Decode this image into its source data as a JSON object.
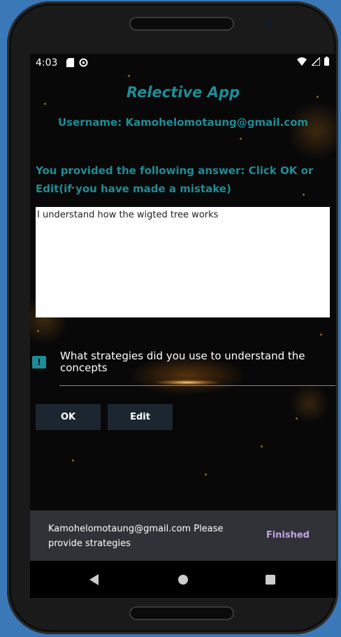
{
  "status_bar": {
    "time": "4:03",
    "left_icons": [
      "sd-card-icon",
      "sync-icon"
    ],
    "right_icons": [
      "wifi-icon",
      "signal-icon",
      "battery-icon"
    ]
  },
  "app": {
    "title": "Relective App",
    "username_label": "Username: Kamohelomotaung@gmail.com",
    "prompt": "You provided the following answer: Click OK or Edit(if you have made a mistake)",
    "answer": "I understand how the wigted tree works",
    "question": "What strategies did you use to understand the concepts",
    "ok_label": "OK",
    "edit_label": "Edit"
  },
  "snackbar": {
    "message": "Kamohelomotaung@gmail.com Please provide strategies",
    "action": "Finished"
  },
  "colors": {
    "accent": "#1e8c96",
    "button_bg": "#1b2630",
    "snackbar_bg": "#2f3236",
    "snackbar_action": "#c3a0e6"
  }
}
